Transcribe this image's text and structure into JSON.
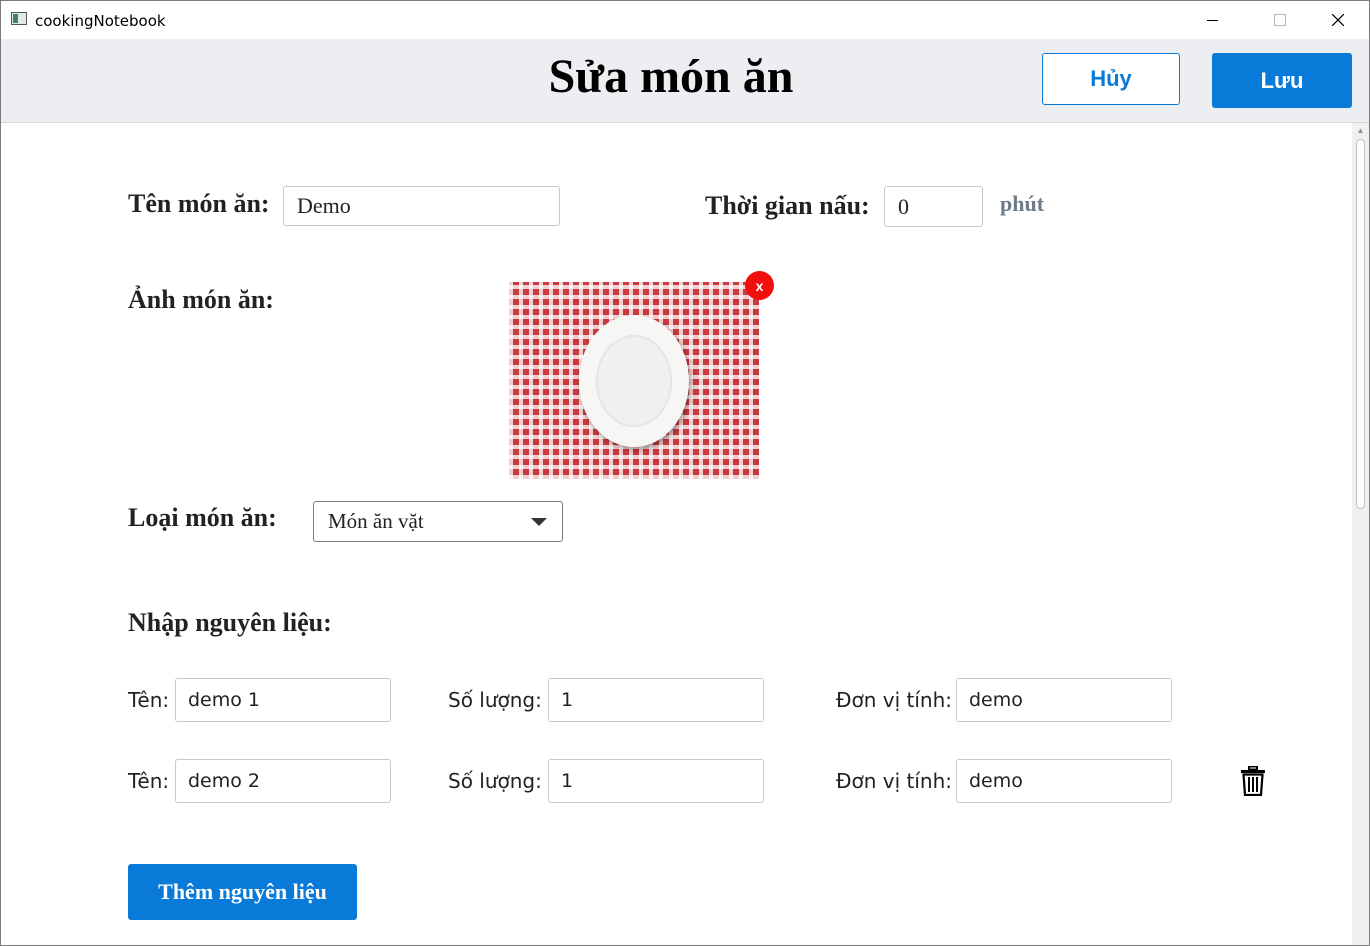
{
  "window": {
    "title": "cookingNotebook"
  },
  "header": {
    "title": "Sửa món ăn",
    "cancel_label": "Hủy",
    "save_label": "Lưu"
  },
  "form": {
    "name_label": "Tên món ăn:",
    "name_value": "Demo",
    "cook_time_label": "Thời gian nấu:",
    "cook_time_value": "0",
    "cook_time_unit": "phút",
    "photo_label": "Ảnh món ăn:",
    "photo_remove_label": "x",
    "category_label": "Loại món ăn:",
    "category_value": "Món ăn vặt",
    "ingredients_heading": "Nhập nguyên liệu:"
  },
  "ingredients": [
    {
      "name_label": "Tên:",
      "name": "demo 1",
      "qty_label": "Số lượng:",
      "qty": "1",
      "unit_label": "Đơn vị tính:",
      "unit": "demo"
    },
    {
      "name_label": "Tên:",
      "name": "demo 2",
      "qty_label": "Số lượng:",
      "qty": "1",
      "unit_label": "Đơn vị tính:",
      "unit": "demo"
    }
  ],
  "add_ingredient_label": "Thêm nguyên liệu",
  "icons": {
    "app": "app-window-icon",
    "delete": "trash-icon",
    "dropdown": "chevron-down-icon"
  },
  "colors": {
    "accent": "#0a7ad8",
    "remove_badge": "#f2100f",
    "header_bg": "#edeef1",
    "unit_text": "#6f7b86"
  }
}
